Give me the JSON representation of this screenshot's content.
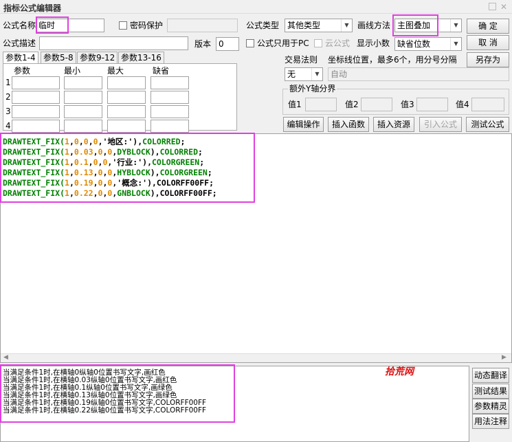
{
  "window": {
    "title": "指标公式编辑器"
  },
  "form": {
    "name_label": "公式名称",
    "name_value": "临时",
    "password_label": "密码保护",
    "type_label": "公式类型",
    "type_value": "其他类型",
    "draw_label": "画线方法",
    "draw_value": "主图叠加",
    "desc_label": "公式描述",
    "desc_value": "",
    "version_label": "版本",
    "version_value": "0",
    "pc_only_label": "公式只用于PC",
    "cloud_label": "云公式",
    "decimals_label": "显示小数",
    "decimals_value": "缺省位数"
  },
  "buttons": {
    "ok": "确  定",
    "cancel": "取  消",
    "save_as": "另存为",
    "edit_ops": "编辑操作",
    "insert_func": "插入函数",
    "insert_res": "插入资源",
    "import_formula": "引入公式",
    "test_formula": "测试公式",
    "dyn_translate": "动态翻译",
    "test_result": "测试结果",
    "param_wizard": "参数精灵",
    "usage_notes": "用法注释"
  },
  "params": {
    "tabs": [
      "参数1-4",
      "参数5-8",
      "参数9-12",
      "参数13-16"
    ],
    "headers": [
      "参数",
      "最小",
      "最大",
      "缺省"
    ],
    "rows": [
      "1",
      "2",
      "3",
      "4"
    ]
  },
  "trade": {
    "rule_label": "交易法则",
    "rule_value": "无",
    "coord_label": "坐标线位置，最多6个，用分号分隔",
    "coord_placeholder": "自动"
  },
  "yaxis": {
    "title": "额外Y轴分界",
    "labels": [
      "值1",
      "值2",
      "值3",
      "值4"
    ]
  },
  "code": {
    "lines": [
      [
        [
          "fn",
          "DRAWTEXT_FIX("
        ],
        [
          "num",
          "1"
        ],
        [
          "p",
          ","
        ],
        [
          "num",
          "0"
        ],
        [
          "p",
          ","
        ],
        [
          "num",
          "0"
        ],
        [
          "p",
          ","
        ],
        [
          "num",
          "0"
        ],
        [
          "p",
          ",'"
        ],
        [
          "str",
          "地区:"
        ],
        [
          "p",
          "'),"
        ],
        [
          "kw",
          "COLORRED"
        ],
        [
          "p",
          ";"
        ]
      ],
      [
        [
          "fn",
          "DRAWTEXT_FIX("
        ],
        [
          "num",
          "1"
        ],
        [
          "p",
          ","
        ],
        [
          "num",
          "0.03"
        ],
        [
          "p",
          ","
        ],
        [
          "num",
          "0"
        ],
        [
          "p",
          ","
        ],
        [
          "num",
          "0"
        ],
        [
          "p",
          ","
        ],
        [
          "kw",
          "DYBLOCK"
        ],
        [
          "p",
          "),"
        ],
        [
          "kw",
          "COLORRED"
        ],
        [
          "p",
          ";"
        ]
      ],
      [
        [
          "fn",
          "DRAWTEXT_FIX("
        ],
        [
          "num",
          "1"
        ],
        [
          "p",
          ","
        ],
        [
          "num",
          "0.1"
        ],
        [
          "p",
          ","
        ],
        [
          "num",
          "0"
        ],
        [
          "p",
          ","
        ],
        [
          "num",
          "0"
        ],
        [
          "p",
          ",'"
        ],
        [
          "str",
          "行业:"
        ],
        [
          "p",
          "'),"
        ],
        [
          "kw",
          "COLORGREEN"
        ],
        [
          "p",
          ";"
        ]
      ],
      [
        [
          "fn",
          "DRAWTEXT_FIX("
        ],
        [
          "num",
          "1"
        ],
        [
          "p",
          ","
        ],
        [
          "num",
          "0.13"
        ],
        [
          "p",
          ","
        ],
        [
          "num",
          "0"
        ],
        [
          "p",
          ","
        ],
        [
          "num",
          "0"
        ],
        [
          "p",
          ","
        ],
        [
          "kw",
          "HYBLOCK"
        ],
        [
          "p",
          "),"
        ],
        [
          "kw",
          "COLORGREEN"
        ],
        [
          "p",
          ";"
        ]
      ],
      [
        [
          "fn",
          "DRAWTEXT_FIX("
        ],
        [
          "num",
          "1"
        ],
        [
          "p",
          ","
        ],
        [
          "num",
          "0.19"
        ],
        [
          "p",
          ","
        ],
        [
          "num",
          "0"
        ],
        [
          "p",
          ","
        ],
        [
          "num",
          "0"
        ],
        [
          "p",
          ",'"
        ],
        [
          "str",
          "概念:"
        ],
        [
          "p",
          "'),"
        ],
        [
          "kwb",
          "COLORFF00FF"
        ],
        [
          "p",
          ";"
        ]
      ],
      [
        [
          "fn",
          "DRAWTEXT_FIX("
        ],
        [
          "num",
          "1"
        ],
        [
          "p",
          ","
        ],
        [
          "num",
          "0.22"
        ],
        [
          "p",
          ","
        ],
        [
          "num",
          "0"
        ],
        [
          "p",
          ","
        ],
        [
          "num",
          "0"
        ],
        [
          "p",
          ","
        ],
        [
          "kw",
          "GNBLOCK"
        ],
        [
          "p",
          "),"
        ],
        [
          "kwb",
          "COLORFF00FF"
        ],
        [
          "p",
          ";"
        ]
      ]
    ]
  },
  "output": {
    "lines": [
      "当满足条件1时,在横轴0纵轴0位置书写文字,画红色",
      "当满足条件1时,在横轴0.03纵轴0位置书写文字,画红色",
      "当满足条件1时,在横轴0.1纵轴0位置书写文字,画绿色",
      "当满足条件1时,在横轴0.13纵轴0位置书写文字,画绿色",
      "当满足条件1时,在横轴0.19纵轴0位置书写文字,COLORFF00FF",
      "当满足条件1时,在横轴0.22纵轴0位置书写文字,COLORFF00FF"
    ]
  },
  "watermark": "拾荒网",
  "colors": {
    "highlight": "#e040e0",
    "function": "#008000",
    "number": "#e08a00",
    "watermark": "#e01010"
  }
}
